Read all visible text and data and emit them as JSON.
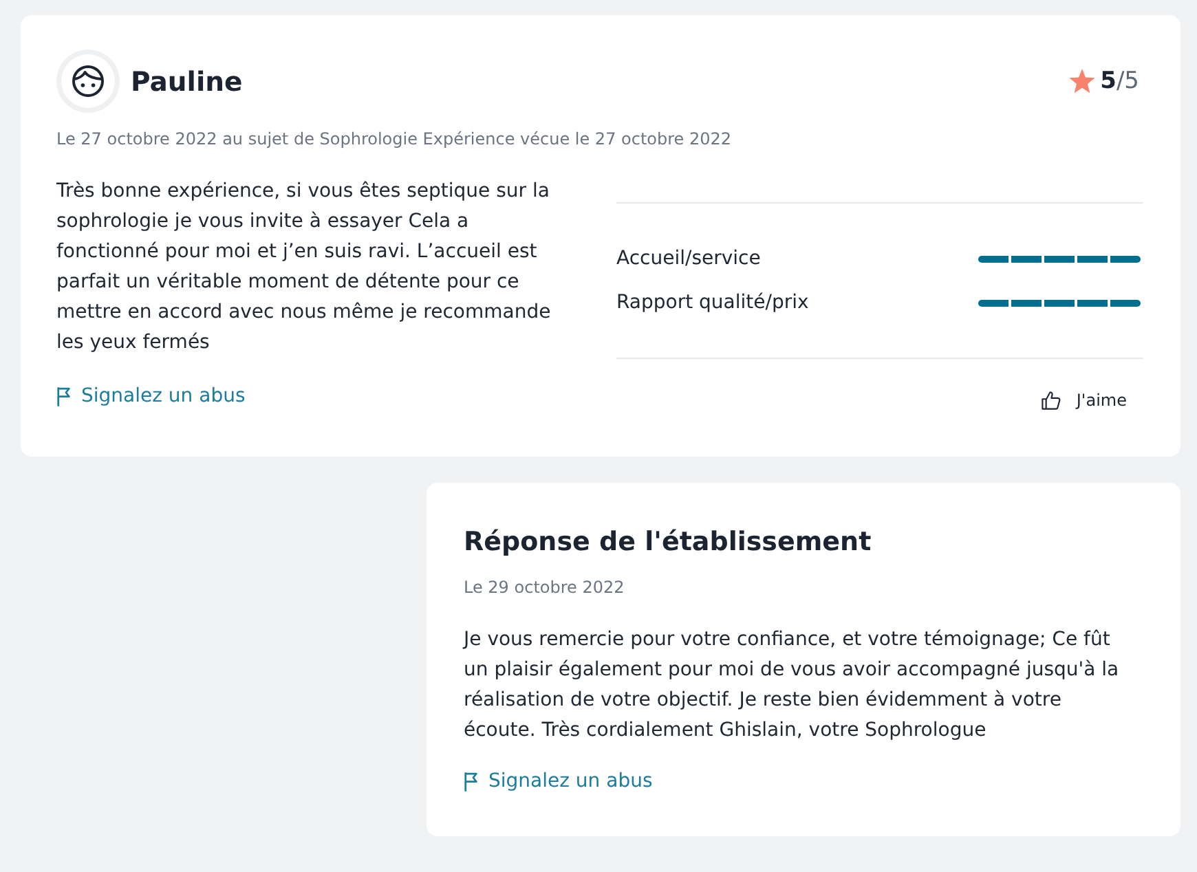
{
  "review": {
    "author": "Pauline",
    "rating": "**5**/5",
    "meta": "Le 27 octobre 2022 au sujet de Sophrologie Expérience vécue le 27 octobre 2022",
    "text": "Très bonne expérience, si vous êtes septique sur la sophrologie je vous invite à essayer Cela a fonctionné pour moi et j’en suis ravi. L’accueil est parfait un véritable moment de détente pour ce mettre en accord avec nous même je recommande les yeux fermés",
    "criteria": [
      {
        "label": "Accueil/service",
        "stars": 5
      },
      {
        "label": "Rapport qualité/prix",
        "stars": 5
      }
    ],
    "report_link": "Signalez un abus",
    "like_button": "J'aime"
  },
  "reply": {
    "title": "Réponse de l'établissement",
    "date": "Le 29 octobre 2022",
    "text": "Je vous remercie pour votre confiance, et votre témoignage; Ce fût un plaisir également pour moi de vous avoir accompagné jusqu'à la réalisation de votre objectif. Je reste bien évidemment à votre écoute. Très cordialement Ghislain, votre Sophrologue",
    "report_link": "Signalez un abus"
  }
}
